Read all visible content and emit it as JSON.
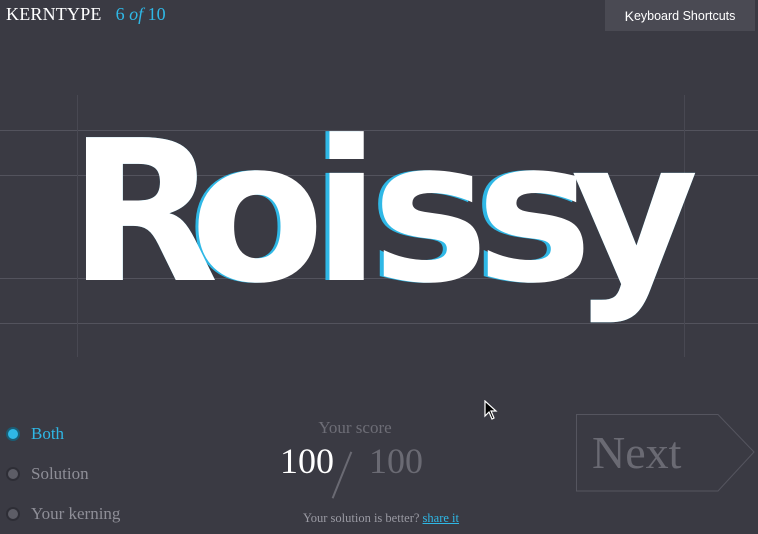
{
  "header": {
    "brand": "KERNTYPE",
    "progress_current": "6",
    "progress_of": "of",
    "progress_total": "10"
  },
  "keyboard_shortcuts": {
    "label_initial": "K",
    "label_rest": "eyboard Shortcuts"
  },
  "specimen": {
    "word": "Roissy",
    "letters": [
      "R",
      "o",
      "i",
      "s",
      "s",
      "y"
    ],
    "solution_color": "#2fb8e6",
    "user_color": "#ffffff"
  },
  "view_options": [
    {
      "label": "Both",
      "selected": true
    },
    {
      "label": "Solution",
      "selected": false
    },
    {
      "label": "Your kerning",
      "selected": false
    }
  ],
  "score": {
    "caption": "Your score",
    "value": "100",
    "max": "100"
  },
  "next_label": "Next",
  "footer": {
    "text": "Your solution is better?",
    "link": "share it"
  },
  "colors": {
    "background": "#3a3a43",
    "accent": "#2fb8e6"
  }
}
